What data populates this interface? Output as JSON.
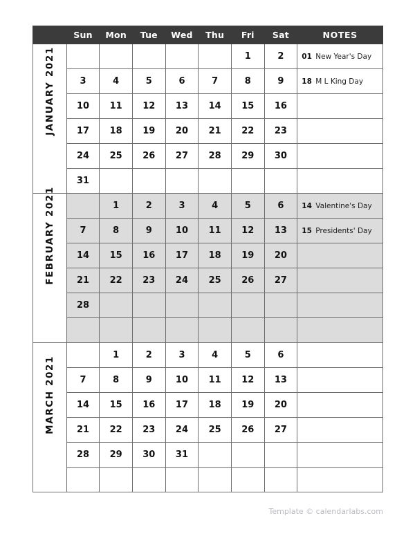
{
  "header": {
    "corner_label": "",
    "weekdays": [
      "Sun",
      "Mon",
      "Tue",
      "Wed",
      "Thu",
      "Fri",
      "Sat"
    ],
    "notes_label": "NOTES"
  },
  "footer": {
    "credit": "Template © calendarlabs.com"
  },
  "colors": {
    "header_bg": "#3b3b3b",
    "header_text": "#ffffff",
    "grid_line": "#6b6b6b",
    "shaded_row_bg": "#dcdcdc",
    "cell_bg": "#ffffff",
    "text": "#111111",
    "footer_text": "#b9b9c0"
  },
  "months": [
    {
      "label": "JANUARY 2021",
      "shaded": false,
      "weeks": [
        [
          "",
          "",
          "",
          "",
          "",
          "1",
          "2"
        ],
        [
          "3",
          "4",
          "5",
          "6",
          "7",
          "8",
          "9"
        ],
        [
          "10",
          "11",
          "12",
          "13",
          "14",
          "15",
          "16"
        ],
        [
          "17",
          "18",
          "19",
          "20",
          "21",
          "22",
          "23"
        ],
        [
          "24",
          "25",
          "26",
          "27",
          "28",
          "29",
          "30"
        ],
        [
          "31",
          "",
          "",
          "",
          "",
          "",
          ""
        ]
      ],
      "notes": [
        {
          "day": "01",
          "text": "New Year's Day"
        },
        {
          "day": "18",
          "text": "M L King Day"
        },
        {
          "day": "",
          "text": ""
        },
        {
          "day": "",
          "text": ""
        },
        {
          "day": "",
          "text": ""
        },
        {
          "day": "",
          "text": ""
        }
      ]
    },
    {
      "label": "FEBRUARY 2021",
      "shaded": true,
      "weeks": [
        [
          "",
          "1",
          "2",
          "3",
          "4",
          "5",
          "6"
        ],
        [
          "7",
          "8",
          "9",
          "10",
          "11",
          "12",
          "13"
        ],
        [
          "14",
          "15",
          "16",
          "17",
          "18",
          "19",
          "20"
        ],
        [
          "21",
          "22",
          "23",
          "24",
          "25",
          "26",
          "27"
        ],
        [
          "28",
          "",
          "",
          "",
          "",
          "",
          ""
        ],
        [
          "",
          "",
          "",
          "",
          "",
          "",
          ""
        ]
      ],
      "notes": [
        {
          "day": "14",
          "text": "Valentine's Day"
        },
        {
          "day": "15",
          "text": "Presidents' Day"
        },
        {
          "day": "",
          "text": ""
        },
        {
          "day": "",
          "text": ""
        },
        {
          "day": "",
          "text": ""
        },
        {
          "day": "",
          "text": ""
        }
      ]
    },
    {
      "label": "MARCH 2021",
      "shaded": false,
      "weeks": [
        [
          "",
          "1",
          "2",
          "3",
          "4",
          "5",
          "6"
        ],
        [
          "7",
          "8",
          "9",
          "10",
          "11",
          "12",
          "13"
        ],
        [
          "14",
          "15",
          "16",
          "17",
          "18",
          "19",
          "20"
        ],
        [
          "21",
          "22",
          "23",
          "24",
          "25",
          "26",
          "27"
        ],
        [
          "28",
          "29",
          "30",
          "31",
          "",
          "",
          ""
        ],
        [
          "",
          "",
          "",
          "",
          "",
          "",
          ""
        ]
      ],
      "notes": [
        {
          "day": "",
          "text": ""
        },
        {
          "day": "",
          "text": ""
        },
        {
          "day": "",
          "text": ""
        },
        {
          "day": "",
          "text": ""
        },
        {
          "day": "",
          "text": ""
        },
        {
          "day": "",
          "text": ""
        }
      ]
    }
  ]
}
